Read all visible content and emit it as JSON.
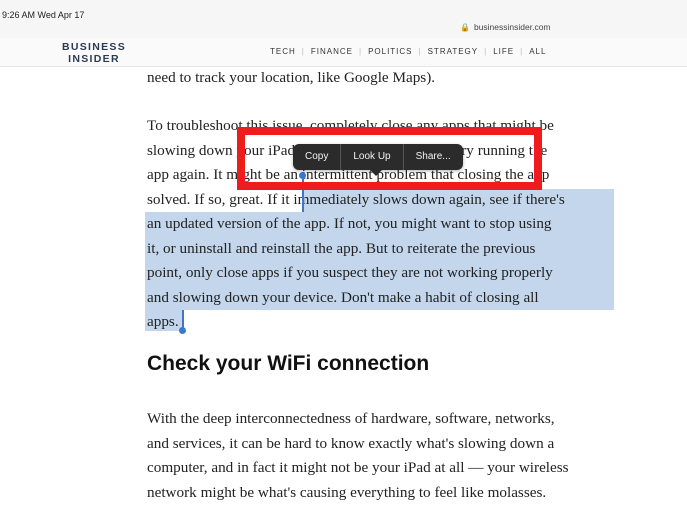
{
  "status": {
    "time": "9:26 AM  Wed Apr 17",
    "url": "businessinsider.com"
  },
  "site": {
    "logo_line1": "BUSINESS",
    "logo_line2": "INSIDER",
    "nav": [
      "TECH",
      "FINANCE",
      "POLITICS",
      "STRATEGY",
      "LIFE",
      "ALL"
    ]
  },
  "article": {
    "para0": "need to track your location, like Google Maps).",
    "para1_lines": [
      "To troubleshoot this issue, completely close any apps that might be",
      "slowing down your iPad. If that fixes the problem, try running the",
      "app again. It might be an intermittent problem that closing the app",
      "solved. If so, great. If it immediately slows down again, see if there's",
      "an updated version of the app. If not, you might want to stop using",
      "it, or uninstall and reinstall the app. But to reiterate the previous",
      "point, only close apps if you suspect they are not working properly",
      "and slowing down your device. Don't make a habit of closing all",
      "apps."
    ],
    "heading": "Check your WiFi connection",
    "para2_lines": [
      "With the deep interconnectedness of hardware, software, networks,",
      "and services, it can be hard to know exactly what's slowing down a",
      "computer, and in fact it might not be your iPad at all — your wireless",
      "network might be what's causing everything to feel like molasses."
    ]
  },
  "popover": {
    "copy": "Copy",
    "lookup": "Look Up",
    "share": "Share..."
  }
}
